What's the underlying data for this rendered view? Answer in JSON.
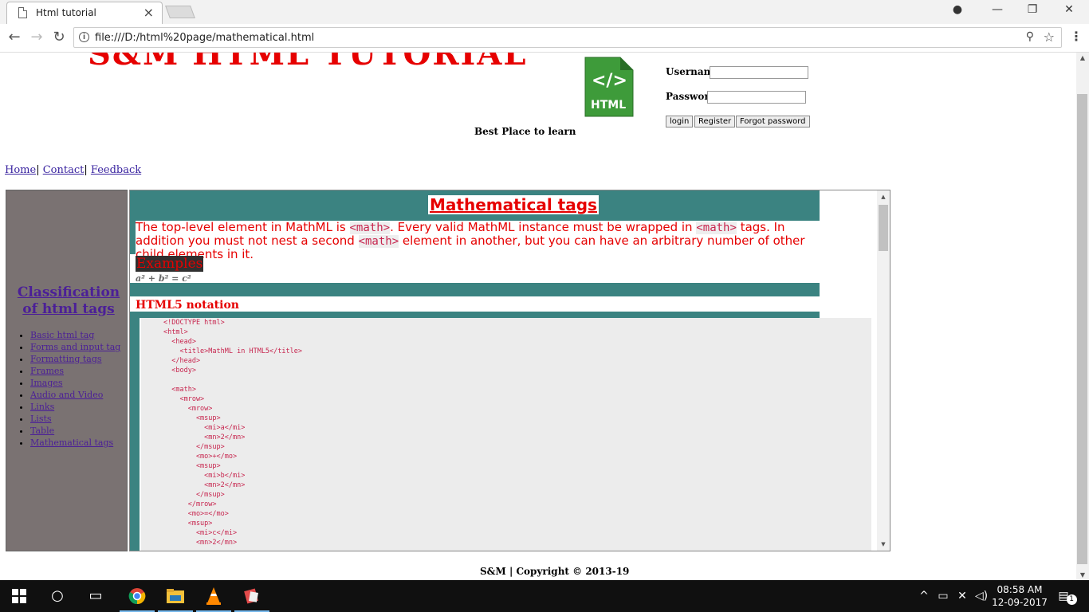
{
  "browser": {
    "tab_title": "Html tutorial",
    "url": "file:///D:/html%20page/mathematical.html"
  },
  "site": {
    "title": "S&M HTML TUTORIAL",
    "tagline": "Best Place to learn",
    "logo_text": "HTML"
  },
  "login": {
    "username_label": "Username",
    "password_label": "Password",
    "buttons": [
      "login",
      "Register",
      "Forgot password"
    ]
  },
  "nav": {
    "links": [
      "Home",
      "Contact",
      "Feedback"
    ],
    "separator": "|"
  },
  "sidebar": {
    "title": "Classification of html tags",
    "items": [
      "Basic html tag",
      "Forms and input tag",
      "Formatting tags",
      "Frames",
      "Images",
      "Audio and Video",
      "Links",
      "Lists",
      "Table",
      "Mathematical tags"
    ]
  },
  "content": {
    "heading": "Mathematical tags",
    "intro_part1": "The top-level element in MathML is ",
    "intro_code1": "<math>",
    "intro_part2": ". Every valid MathML instance must be wrapped in ",
    "intro_code2": "<math>",
    "intro_part3": " tags. In addition you must not nest a second ",
    "intro_code3": "<math>",
    "intro_part4": " element in another, but you can have an arbitrary number of other child elements in it.",
    "examples_label": "Examples",
    "formula": "a² + b² = c²",
    "html5_label": "HTML5 notation",
    "code_lines": [
      "<!DOCTYPE html>",
      "<html>",
      "  <head>",
      "    <title>MathML in HTML5</title>",
      "  </head>",
      "  <body>",
      "",
      "  <math>",
      "    <mrow>",
      "      <mrow>",
      "        <msup>",
      "          <mi>a</mi>",
      "          <mn>2</mn>",
      "        </msup>",
      "        <mo>+</mo>",
      "        <msup>",
      "          <mi>b</mi>",
      "          <mn>2</mn>",
      "        </msup>",
      "      </mrow>",
      "      <mo>=</mo>",
      "      <msup>",
      "        <mi>c</mi>",
      "        <mn>2</mn>"
    ]
  },
  "footer": {
    "text": "S&M | Copyright © 2013-19"
  },
  "taskbar": {
    "time": "08:58 AM",
    "date": "12-09-2017",
    "notification_count": "1"
  },
  "colors": {
    "title_red": "#e60000",
    "teal": "#3b8381",
    "sidebar_gray": "#7a7272",
    "link_purple": "#4b1f97"
  },
  "icons": [
    "doc-icon",
    "close-icon",
    "user-icon",
    "minimize-icon",
    "restore-icon",
    "back-icon",
    "forward-icon",
    "reload-icon",
    "info-icon",
    "zoom-icon",
    "star-icon",
    "menu-icon",
    "windows-start-icon",
    "cortana-icon",
    "task-view-icon",
    "chrome-icon",
    "file-explorer-icon",
    "vlc-icon",
    "app-icon",
    "tray-chevron-icon",
    "battery-icon",
    "network-icon",
    "volume-icon",
    "action-center-icon"
  ]
}
